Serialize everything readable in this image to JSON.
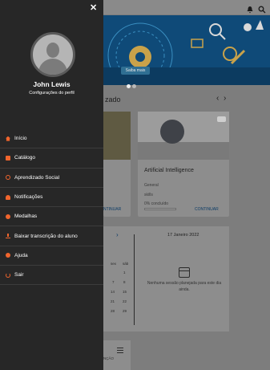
{
  "banner": {
    "cta": "Saiba mais"
  },
  "section": {
    "title": "zado",
    "prev": "‹",
    "next": "›"
  },
  "card": {
    "title": "Artificial Intelligence",
    "category": "General",
    "type": "skills",
    "progress_text": "0% concluído",
    "progress": 0,
    "action": "CONTINUAR"
  },
  "card_left": {
    "action": "NTINUAR"
  },
  "calendar": {
    "next_arrow": "›",
    "date": "17 Janeiro 2022",
    "empty_message": "Nenhuma sessão planejada para este dia ainda.",
    "day_headers": [
      "sex",
      "sáb"
    ],
    "weeks": [
      [
        "",
        "1"
      ],
      [
        "7",
        "8"
      ],
      [
        "14",
        "15"
      ],
      [
        "21",
        "22"
      ],
      [
        "28",
        "29"
      ]
    ]
  },
  "bottom_card": {
    "text": "NÇÃO"
  },
  "drawer": {
    "close": "✕",
    "user_name": "John Lewis",
    "profile_link": "Configurações do perfil",
    "menu": [
      {
        "label": "Início",
        "icon": "home-icon"
      },
      {
        "label": "Catálogo",
        "icon": "book-icon"
      },
      {
        "label": "Aprendizado Social",
        "icon": "social-icon"
      },
      {
        "label": "Notificações",
        "icon": "bell-icon"
      },
      {
        "label": "Medalhas",
        "icon": "medal-icon"
      },
      {
        "label": "Baixar transcrição do aluno",
        "icon": "download-icon"
      },
      {
        "label": "Ajuda",
        "icon": "help-icon"
      },
      {
        "label": "Sair",
        "icon": "power-icon"
      }
    ],
    "accent_color": "#f0652d"
  }
}
